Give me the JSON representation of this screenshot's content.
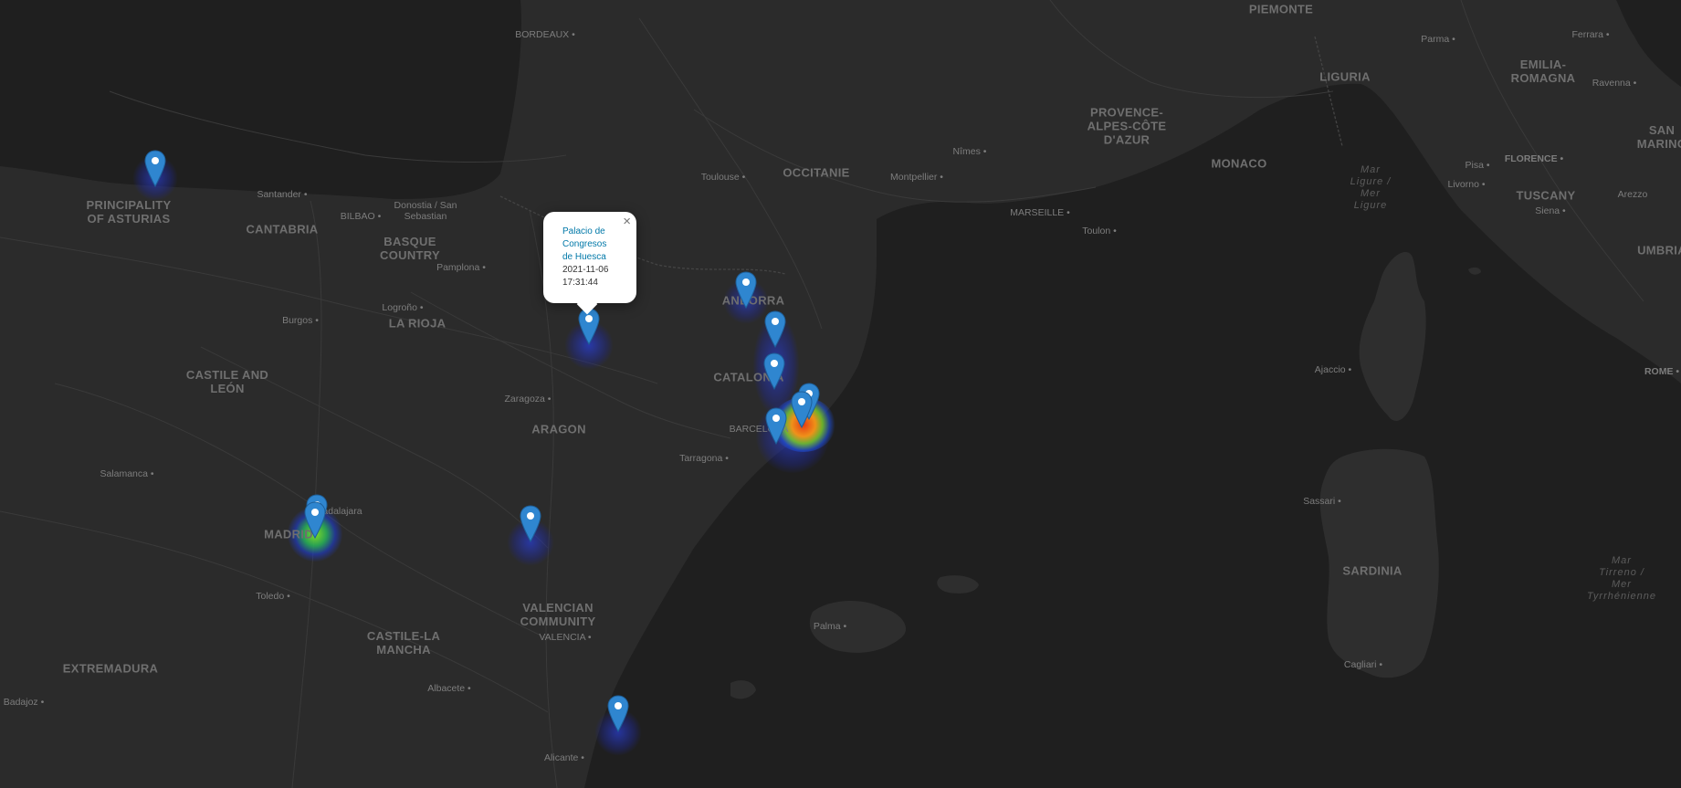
{
  "map": {
    "colors": {
      "background": "#2b2b2b",
      "sea": "#1f1f1f",
      "land": "#2e2e2e",
      "marker": "#2f86d0"
    },
    "regions": [
      {
        "id": "asturias",
        "lines": [
          "PRINCIPALITY",
          "OF ASTURIAS"
        ]
      },
      {
        "id": "cantabria",
        "lines": [
          "CANTABRIA"
        ]
      },
      {
        "id": "basque",
        "lines": [
          "BASQUE",
          "COUNTRY"
        ]
      },
      {
        "id": "rioja",
        "lines": [
          "LA RIOJA"
        ]
      },
      {
        "id": "castile-leon",
        "lines": [
          "CASTILE AND",
          "LEÓN"
        ]
      },
      {
        "id": "aragon",
        "lines": [
          "ARAGON"
        ]
      },
      {
        "id": "catalonia",
        "lines": [
          "CATALONIA"
        ]
      },
      {
        "id": "andorra",
        "lines": [
          "ANDORRA"
        ]
      },
      {
        "id": "madrid",
        "lines": [
          "MADRID"
        ]
      },
      {
        "id": "castile-mancha",
        "lines": [
          "CASTILE-LA",
          "MANCHA"
        ]
      },
      {
        "id": "extremadura",
        "lines": [
          "EXTREMADURA"
        ]
      },
      {
        "id": "valencian",
        "lines": [
          "VALENCIAN",
          "COMMUNITY"
        ]
      },
      {
        "id": "occitanie",
        "lines": [
          "OCCITANIE"
        ]
      },
      {
        "id": "provence",
        "lines": [
          "PROVENCE-",
          "ALPES-CÔTE",
          "D'AZUR"
        ]
      },
      {
        "id": "monaco",
        "lines": [
          "MONACO"
        ]
      },
      {
        "id": "piemonte",
        "lines": [
          "PIEMONTE"
        ]
      },
      {
        "id": "liguria",
        "lines": [
          "LIGURIA"
        ]
      },
      {
        "id": "emilia",
        "lines": [
          "EMILIA-",
          "ROMAGNA"
        ]
      },
      {
        "id": "tuscany",
        "lines": [
          "TUSCANY"
        ]
      },
      {
        "id": "sardinia",
        "lines": [
          "SARDINIA"
        ]
      },
      {
        "id": "umbria",
        "lines": [
          "UMBRIA"
        ]
      },
      {
        "id": "sanmarino",
        "lines": [
          "SAN",
          "MARINO"
        ]
      }
    ],
    "cities": [
      {
        "id": "bordeaux",
        "name": "BORDEAUX"
      },
      {
        "id": "santander",
        "name": "Santander"
      },
      {
        "id": "bilbao",
        "name": "BILBAO"
      },
      {
        "id": "donostia",
        "name": "Donostia / San Sebastian"
      },
      {
        "id": "pamplona",
        "name": "Pamplona"
      },
      {
        "id": "logrono",
        "name": "Logroño"
      },
      {
        "id": "burgos",
        "name": "Burgos"
      },
      {
        "id": "zaragoza",
        "name": "Zaragoza"
      },
      {
        "id": "salamanca",
        "name": "Salamanca"
      },
      {
        "id": "guadalajara",
        "name": "Guadalajara"
      },
      {
        "id": "toledo",
        "name": "Toledo"
      },
      {
        "id": "badajoz",
        "name": "Badajoz"
      },
      {
        "id": "albacete",
        "name": "Albacete"
      },
      {
        "id": "valencia",
        "name": "VALENCIA"
      },
      {
        "id": "alicante",
        "name": "Alicante"
      },
      {
        "id": "tarragona",
        "name": "Tarragona"
      },
      {
        "id": "barcelona",
        "name": "BARCELONA"
      },
      {
        "id": "toulouse",
        "name": "Toulouse"
      },
      {
        "id": "montpellier",
        "name": "Montpellier"
      },
      {
        "id": "nimes",
        "name": "Nîmes"
      },
      {
        "id": "marseille",
        "name": "MARSEILLE"
      },
      {
        "id": "toulon",
        "name": "Toulon"
      },
      {
        "id": "parma",
        "name": "Parma"
      },
      {
        "id": "ferrara",
        "name": "Ferrara"
      },
      {
        "id": "ravenna",
        "name": "Ravenna"
      },
      {
        "id": "florence",
        "name": "FLORENCE"
      },
      {
        "id": "pisa",
        "name": "Pisa"
      },
      {
        "id": "livorno",
        "name": "Livorno"
      },
      {
        "id": "siena",
        "name": "Siena"
      },
      {
        "id": "arezzo",
        "name": "Arezzo"
      },
      {
        "id": "rome",
        "name": "ROME"
      },
      {
        "id": "ajaccio",
        "name": "Ajaccio"
      },
      {
        "id": "sassari",
        "name": "Sassari"
      },
      {
        "id": "cagliari",
        "name": "Cagliari"
      },
      {
        "id": "palma",
        "name": "Palma"
      }
    ],
    "seas": [
      {
        "id": "ligure",
        "lines": [
          "Mar",
          "Ligure /",
          "Mer",
          "Ligure"
        ]
      },
      {
        "id": "tirreno",
        "lines": [
          "Mar",
          "Tirreno /",
          "Mer",
          "Tyrrhénienne"
        ]
      }
    ],
    "markers": [
      {
        "id": "asturias"
      },
      {
        "id": "huesca"
      },
      {
        "id": "andorra"
      },
      {
        "id": "catalonia-1"
      },
      {
        "id": "catalonia-2"
      },
      {
        "id": "barcelona-1"
      },
      {
        "id": "barcelona-2"
      },
      {
        "id": "barcelona-3"
      },
      {
        "id": "madrid-1"
      },
      {
        "id": "madrid-2"
      },
      {
        "id": "teruel"
      },
      {
        "id": "alicante"
      }
    ],
    "heat_intensity": [
      {
        "id": "asturias",
        "value": 0.3
      },
      {
        "id": "huesca",
        "value": 0.3
      },
      {
        "id": "andorra",
        "value": 0.3
      },
      {
        "id": "catalonia",
        "value": 0.35
      },
      {
        "id": "barcelona",
        "value": 1.0
      },
      {
        "id": "madrid",
        "value": 0.7
      },
      {
        "id": "teruel",
        "value": 0.3
      },
      {
        "id": "alicante",
        "value": 0.3
      }
    ],
    "popup": {
      "venue": "Palacio de Congresos de Huesca",
      "venue_lines": [
        "Palacio de",
        "Congresos",
        "de Huesca"
      ],
      "date": "2021-11-06",
      "time": "17:31:44",
      "close_symbol": "×"
    }
  }
}
